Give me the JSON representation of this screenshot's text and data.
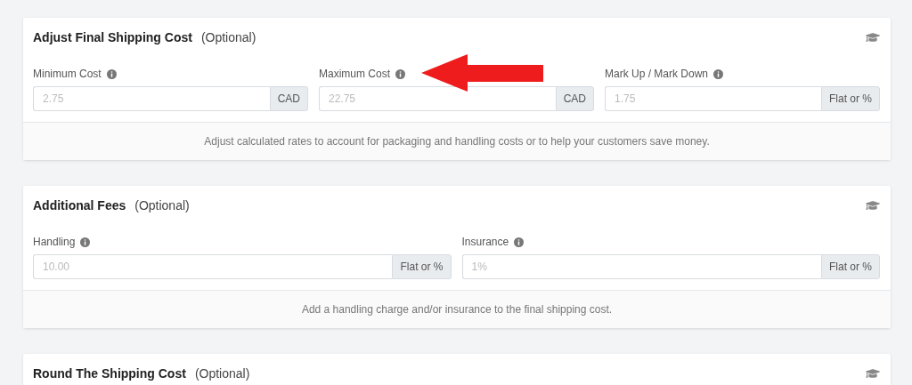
{
  "sections": [
    {
      "title": "Adjust Final Shipping Cost",
      "suffix": "(Optional)",
      "fields": [
        {
          "label": "Minimum Cost",
          "placeholder": "2.75",
          "addon": "CAD"
        },
        {
          "label": "Maximum Cost",
          "placeholder": "22.75",
          "addon": "CAD"
        },
        {
          "label": "Mark Up / Mark Down",
          "placeholder": "1.75",
          "addon": "Flat or %"
        }
      ],
      "note": "Adjust calculated rates to account for packaging and handling costs or to help your customers save money."
    },
    {
      "title": "Additional Fees",
      "suffix": "(Optional)",
      "fields": [
        {
          "label": "Handling",
          "placeholder": "10.00",
          "addon": "Flat or %"
        },
        {
          "label": "Insurance",
          "placeholder": "1%",
          "addon": "Flat or %"
        }
      ],
      "note": "Add a handling charge and/or insurance to the final shipping cost."
    },
    {
      "title": "Round The Shipping Cost",
      "suffix": "(Optional)"
    }
  ]
}
